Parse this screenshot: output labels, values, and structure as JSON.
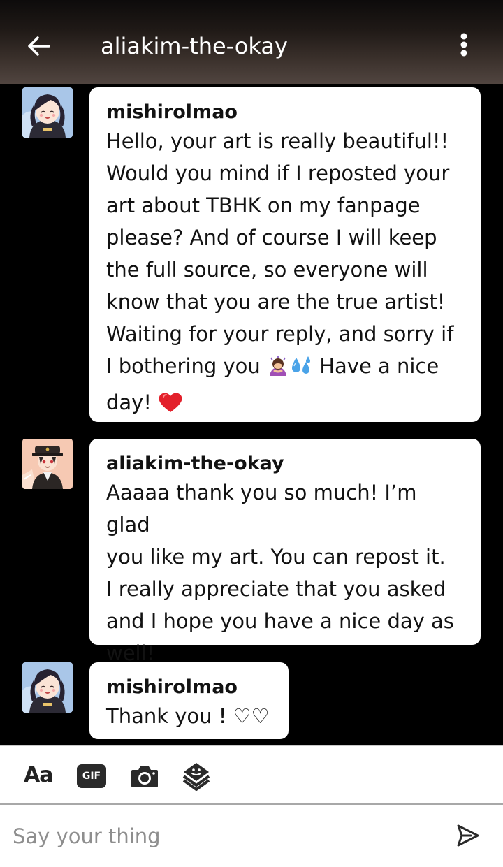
{
  "header": {
    "title": "aliakim-the-okay"
  },
  "messages": [
    {
      "username": "mishirolmao",
      "text_main": "Hello, your art is really beautiful!!\nWould you mind if I reposted your\nart about TBHK on my fanpage\nplease? And of course I will keep\nthe full source, so everyone will\nknow that you are the true artist!\nWaiting for your reply, and sorry if\nI bothering you ",
      "text_after_emoji": " Have a nice\nday! ",
      "emojis": [
        "woman-bowing-emoji",
        "sweat-droplets-emoji",
        "red-heart-emoji"
      ]
    },
    {
      "username": "aliakim-the-okay",
      "text": "Aaaaa thank you so much! I’m glad\nyou like my art. You can repost it.\nI really appreciate that you asked\nand I hope you have a nice day as\nwell!"
    },
    {
      "username": "mishirolmao",
      "text": "Thank you ! ♡♡"
    }
  ],
  "toolbar": {
    "text_format_label": "Aa",
    "gif_label": "GIF"
  },
  "composer": {
    "placeholder": "Say your thing"
  },
  "colors": {
    "bubble": "#ffffff",
    "background": "#000000",
    "text": "#121212",
    "placeholder": "#8e8e8e"
  }
}
